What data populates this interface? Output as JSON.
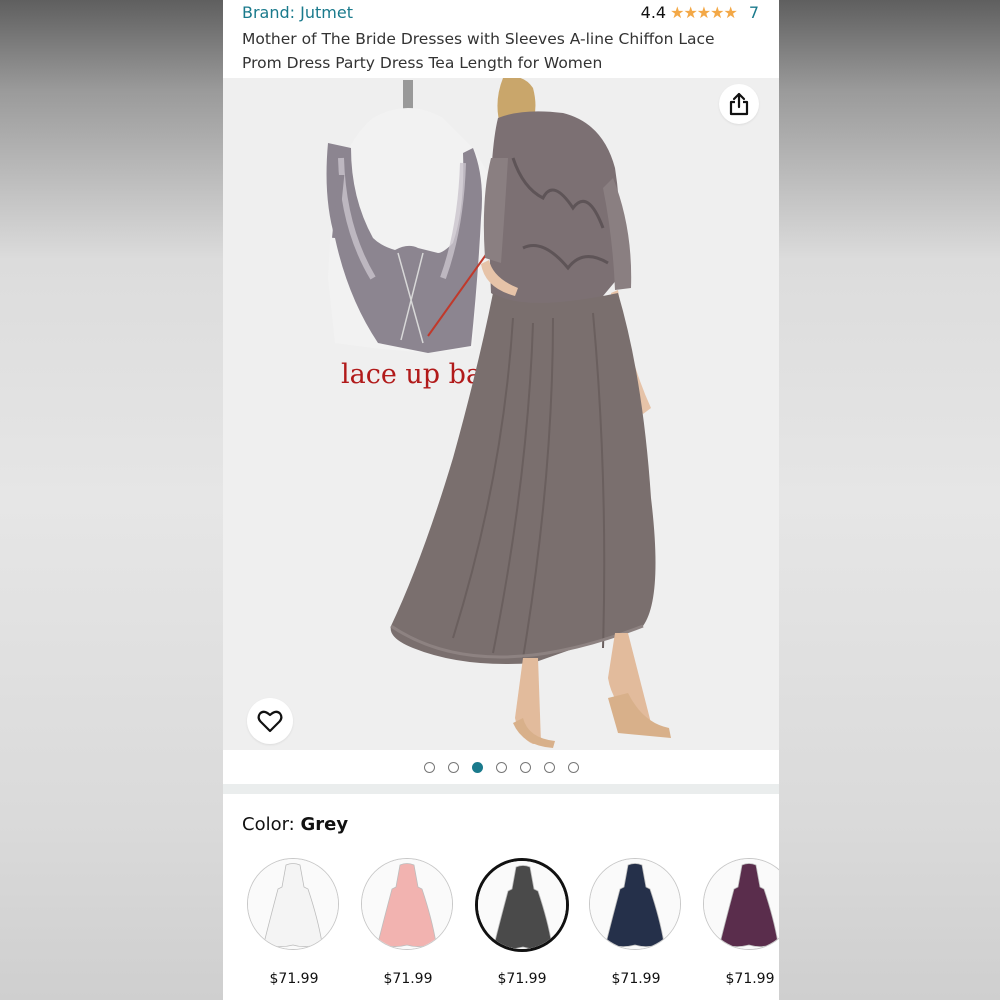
{
  "header": {
    "brand": "Brand: Jutmet",
    "rating_value": "4.4",
    "rating_stars": "★★★★★",
    "rating_count": "7",
    "title": "Mother of The Bride Dresses with Sleeves A-line Chiffon Lace Prom Dress Party Dress Tea Length for Women"
  },
  "gallery": {
    "inset_label": "lace up back",
    "share_icon": "share-icon",
    "favorite_icon": "heart-icon",
    "dot_count": 7,
    "active_dot": 3
  },
  "color": {
    "label": "Color: ",
    "selected": "Grey"
  },
  "swatches": [
    {
      "price": "$71.99",
      "color": "#f4f4f4"
    },
    {
      "price": "$71.99",
      "color": "#f2b3b0"
    },
    {
      "price": "$71.99",
      "color": "#4a4a4a",
      "selected": true
    },
    {
      "price": "$71.99",
      "color": "#25304a"
    },
    {
      "price": "$71.99",
      "color": "#5a2d4c"
    }
  ],
  "colors": {
    "link": "#1a7a8c",
    "star": "#f3a847",
    "dress": "#7a6f6e"
  }
}
